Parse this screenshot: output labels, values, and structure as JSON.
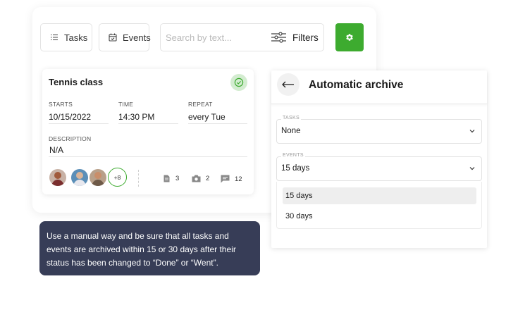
{
  "toolbar": {
    "tasks_label": "Tasks",
    "events_label": "Events",
    "search_placeholder": "Search by text...",
    "filters_label": "Filters",
    "settings_color": "#3dab2f"
  },
  "task_card": {
    "title": "Tennis class",
    "status": "done",
    "fields": {
      "starts_label": "STARTS",
      "starts_value": "10/15/2022",
      "time_label": "TIME",
      "time_value": "14:30 PM",
      "repeat_label": "REPEAT",
      "repeat_value": "every Tue",
      "description_label": "DESCRIPTION",
      "description_value": "N/A"
    },
    "avatars_more": "+8",
    "stats": {
      "documents": "3",
      "photos": "2",
      "comments": "12"
    }
  },
  "tooltip": {
    "text": "Use a manual way and be sure that all tasks and events are archived within 15 or 30 days after their status has been changed to “Done” or “Went”."
  },
  "archive": {
    "title": "Automatic archive",
    "tasks": {
      "label": "TASKS",
      "value": "None"
    },
    "events": {
      "label": "EVENTS",
      "value": "15 days",
      "options": [
        {
          "label": "15 days",
          "selected": true
        },
        {
          "label": "30 days",
          "selected": false
        }
      ]
    }
  }
}
